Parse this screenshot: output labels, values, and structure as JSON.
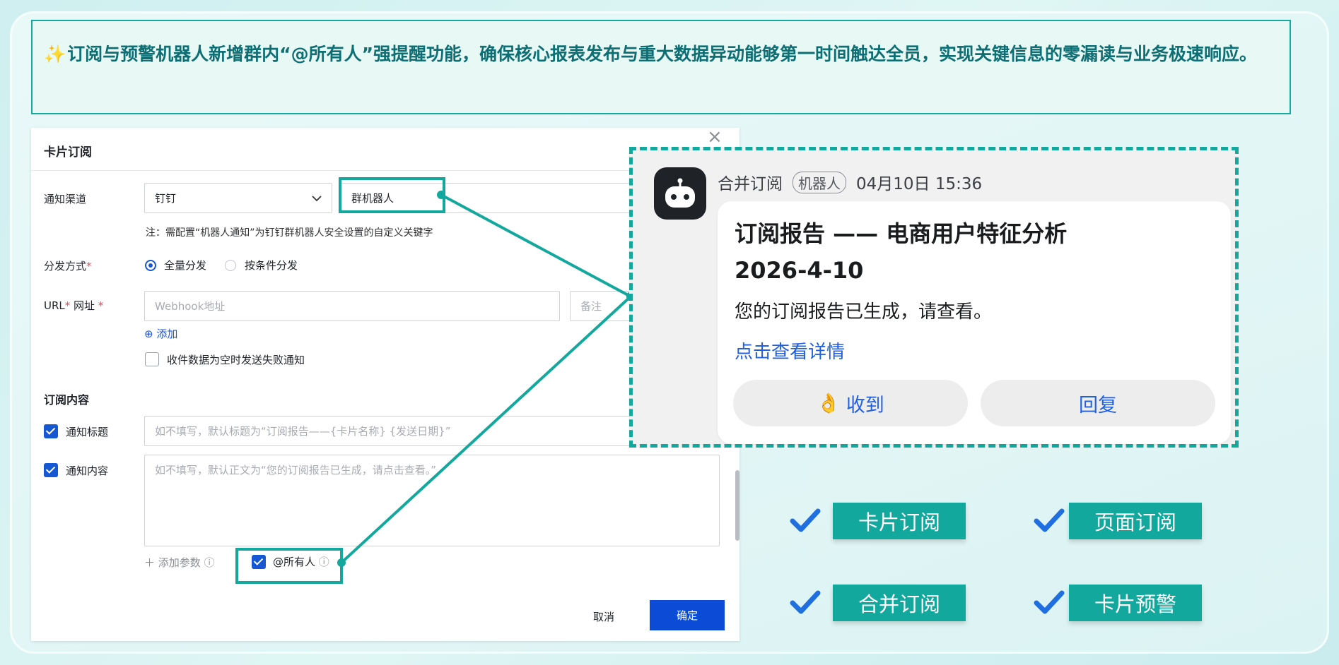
{
  "banner": {
    "spark": "✨",
    "text": "订阅与预警机器人新增群内“@所有人”强提醒功能，确保核心报表发布与重大数据异动能够第一时间触达全员，实现关键信息的零漏读与业务极速响应。"
  },
  "dialog": {
    "title": "卡片订阅",
    "close": "×",
    "channel_label": "通知渠道",
    "channel_value": "钉钉",
    "channel_target": "群机器人",
    "note": "注：需配置“机器人通知”为钉钉群机器人安全设置的自定义关键字",
    "dist_label": "分发方式",
    "dist_all": "全量分发",
    "dist_cond": "按条件分发",
    "url_label": "URL",
    "url_sub": "网址",
    "url_placeholder": "Webhook地址",
    "remark_placeholder": "备注",
    "add": "添加",
    "fail_notice": "收件数据为空时发送失败通知",
    "content_section": "订阅内容",
    "title_check": "通知标题",
    "title_placeholder": "如不填写，默认标题为“订阅报告——{卡片名称} {发送日期}”",
    "content_check": "通知内容",
    "content_placeholder": "如不填写，默认正文为“您的订阅报告已生成，请点击查看。”",
    "add_param": "添加参数",
    "at_all": "@所有人",
    "cancel": "取消",
    "confirm": "确定"
  },
  "notification": {
    "sender": "合并订阅",
    "badge": "机器人",
    "time": "04月10日 15:36",
    "title_line1": "订阅报告 —— 电商用户特征分析",
    "title_line2": "2026-4-10",
    "body": "您的订阅报告已生成，请查看。",
    "link": "点击查看详情",
    "ack_emoji": "👌",
    "ack": "收到",
    "reply": "回复"
  },
  "features": [
    "卡片订阅",
    "页面订阅",
    "合并订阅",
    "卡片预警"
  ],
  "colors": {
    "accent": "#13a89e",
    "primary": "#1657d4",
    "tick": "#1f6fe0"
  }
}
